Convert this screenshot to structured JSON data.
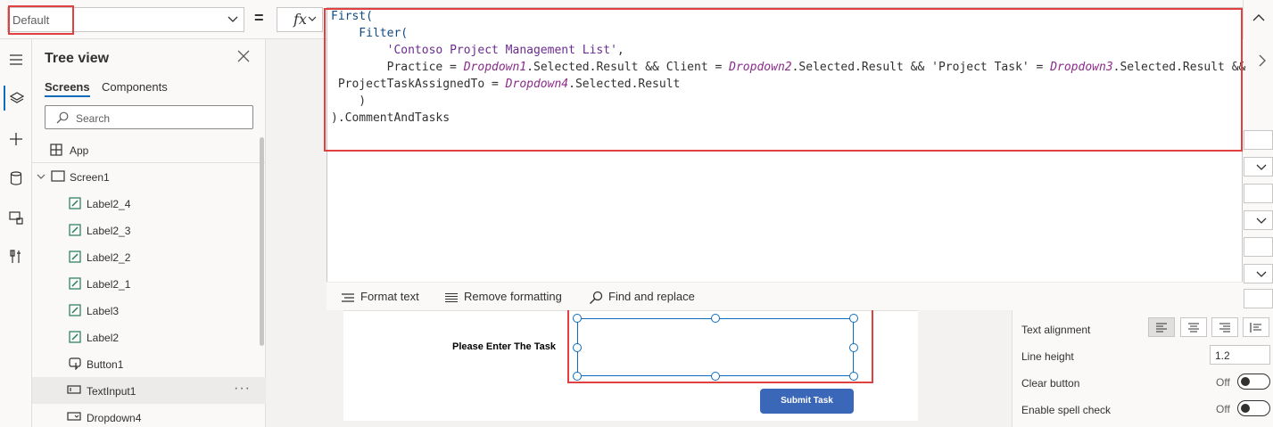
{
  "formula_bar": {
    "property": "Default",
    "equals": "=",
    "fx": "fx",
    "code_lines": [
      [
        {
          "t": "First(",
          "c": "kw"
        }
      ],
      [
        {
          "t": "    Filter(",
          "c": "kw"
        }
      ],
      [
        {
          "t": "        ",
          "c": ""
        },
        {
          "t": "'Contoso Project Management List'",
          "c": "str"
        },
        {
          "t": ",",
          "c": ""
        }
      ],
      [
        {
          "t": "        Practice = ",
          "c": ""
        },
        {
          "t": "Dropdown1",
          "c": "ctrl"
        },
        {
          "t": ".Selected.Result && Client = ",
          "c": ""
        },
        {
          "t": "Dropdown2",
          "c": "ctrl"
        },
        {
          "t": ".Selected.Result && 'Project Task' = ",
          "c": ""
        },
        {
          "t": "Dropdown3",
          "c": "ctrl"
        },
        {
          "t": ".Selected.Result &&",
          "c": ""
        }
      ],
      [
        {
          "t": " ProjectTaskAssignedTo = ",
          "c": ""
        },
        {
          "t": "Dropdown4",
          "c": "ctrl"
        },
        {
          "t": ".Selected.Result",
          "c": ""
        }
      ],
      [
        {
          "t": "    )",
          "c": ""
        }
      ],
      [
        {
          "t": ").CommentAndTasks",
          "c": ""
        }
      ]
    ],
    "toolbar": {
      "format_text": "Format text",
      "remove_formatting": "Remove formatting",
      "find_replace": "Find and replace"
    }
  },
  "tree": {
    "title": "Tree view",
    "tabs": [
      "Screens",
      "Components"
    ],
    "search_placeholder": "Search",
    "app": "App",
    "screen": "Screen1",
    "items": [
      "Label2_4",
      "Label2_3",
      "Label2_2",
      "Label2_1",
      "Label3",
      "Label2",
      "Button1",
      "TextInput1",
      "Dropdown4"
    ],
    "more": "···"
  },
  "canvas": {
    "task_label": "Please Enter The Task",
    "submit": "Submit Task"
  },
  "properties": {
    "text_alignment": "Text alignment",
    "line_height": "Line height",
    "line_height_value": "1.2",
    "clear_button": "Clear button",
    "clear_button_state": "Off",
    "spell_check": "Enable spell check",
    "spell_check_state": "Off",
    "colors": {
      "accent": "#0f6cbd",
      "button": "#3a67b8",
      "highlight": "#e04040"
    }
  }
}
